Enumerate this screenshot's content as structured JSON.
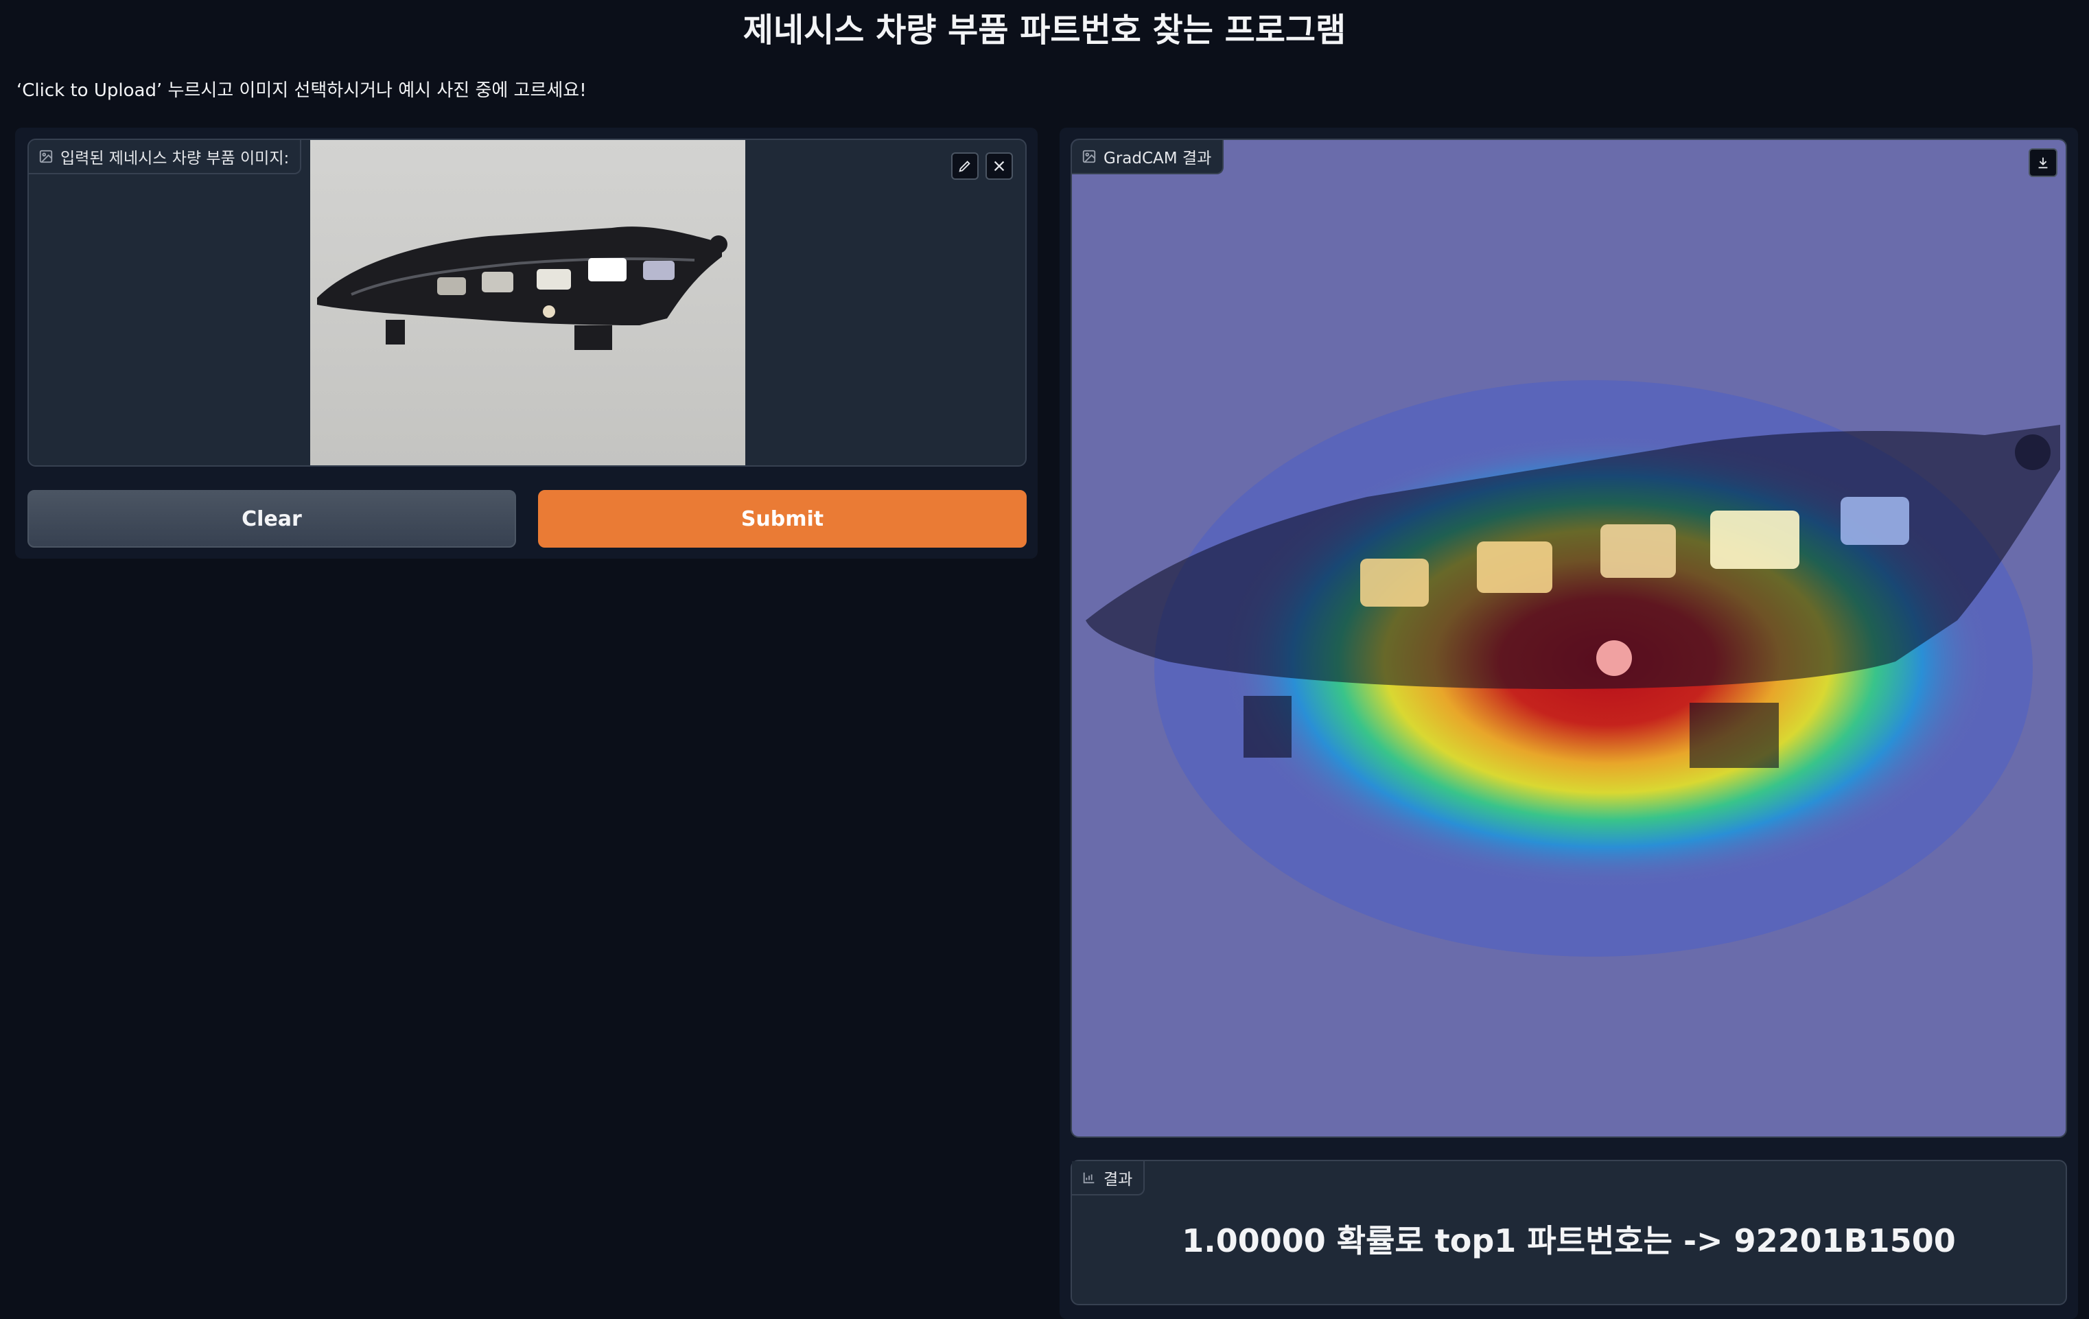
{
  "header": {
    "title": "제네시스 차량 부품 파트번호 찾는 프로그램",
    "instructions": "‘Click to Upload’ 누르시고 이미지 선택하시거나 예시 사진 중에 고르세요!"
  },
  "input": {
    "label": "입력된 제네시스 차량 부품 이미지:",
    "icons": [
      "image-icon",
      "edit-icon",
      "close-icon"
    ]
  },
  "buttons": {
    "clear": "Clear",
    "submit": "Submit",
    "submit_color": "#ea7b35"
  },
  "output": {
    "gradcam_label": "GradCAM 결과",
    "result_label": "결과",
    "result_text": "1.00000 확률로 top1 파트번호는 -> 92201B1500",
    "icons": [
      "image-icon",
      "download-icon",
      "chart-icon"
    ]
  }
}
